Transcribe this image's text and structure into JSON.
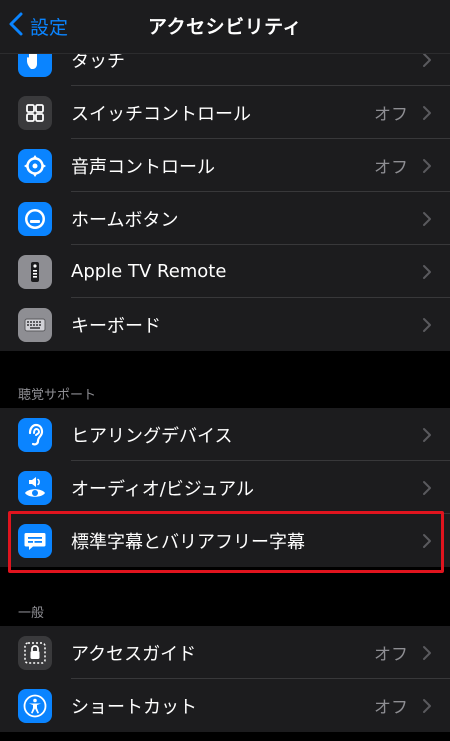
{
  "nav": {
    "back_label": "設定",
    "title": "アクセシビリティ"
  },
  "motor": {
    "items": [
      {
        "label": "タッチ",
        "value": ""
      },
      {
        "label": "スイッチコントロール",
        "value": "オフ"
      },
      {
        "label": "音声コントロール",
        "value": "オフ"
      },
      {
        "label": "ホームボタン",
        "value": ""
      },
      {
        "label": "Apple TV Remote",
        "value": ""
      },
      {
        "label": "キーボード",
        "value": ""
      }
    ]
  },
  "hearing": {
    "header": "聴覚サポート",
    "items": [
      {
        "label": "ヒアリングデバイス",
        "value": ""
      },
      {
        "label": "オーディオ/ビジュアル",
        "value": ""
      },
      {
        "label": "標準字幕とバリアフリー字幕",
        "value": ""
      }
    ]
  },
  "general": {
    "header": "一般",
    "items": [
      {
        "label": "アクセスガイド",
        "value": "オフ"
      },
      {
        "label": "ショートカット",
        "value": "オフ"
      }
    ]
  },
  "colors": {
    "accent": "#0a84ff",
    "highlight": "#e0141e",
    "background": "#000000",
    "cell": "#1c1c1e"
  },
  "icons": [
    "chevron-left-icon",
    "hand-touch-icon",
    "switch-grid-icon",
    "voice-control-icon",
    "home-button-icon",
    "tv-remote-icon",
    "keyboard-icon",
    "ear-icon",
    "audio-visual-icon",
    "subtitles-icon",
    "lock-icon",
    "accessibility-person-icon",
    "chevron-right-icon"
  ]
}
